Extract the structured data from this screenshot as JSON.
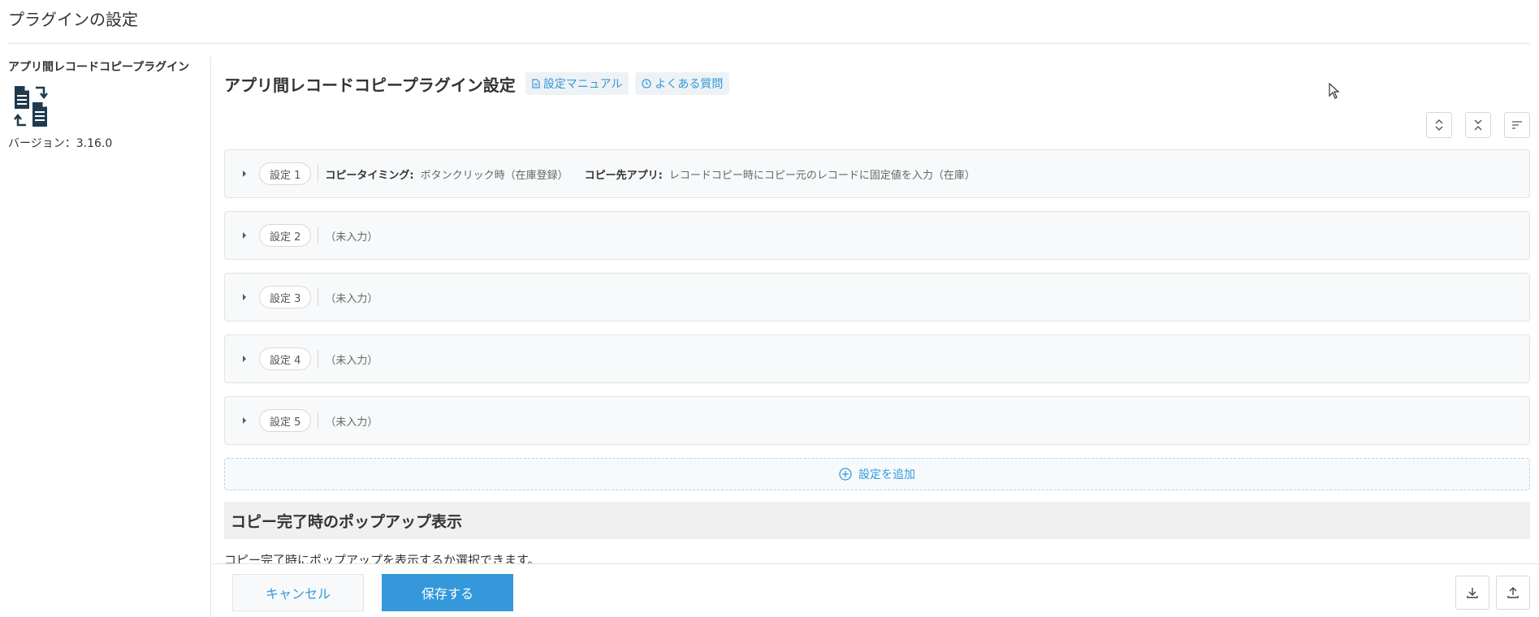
{
  "page": {
    "title": "プラグインの設定"
  },
  "sidebar": {
    "plugin_name": "アプリ間レコードコピープラグイン",
    "version": "バージョン：3.16.0",
    "icon": "copy-documents-icon"
  },
  "main": {
    "title": "アプリ間レコードコピープラグイン設定",
    "links": [
      {
        "label": "設定マニュアル",
        "icon": "document-icon"
      },
      {
        "label": "よくある質問",
        "icon": "question-circle-icon"
      }
    ],
    "tools": [
      "expand-all-icon",
      "collapse-all-icon",
      "sort-icon"
    ]
  },
  "settings": [
    {
      "badge": "設定 1",
      "timing_label": "コピータイミング:",
      "timing_value": "ボタンクリック時（在庫登録）",
      "target_label": "コピー先アプリ:",
      "target_value": "レコードコピー時にコピー元のレコードに固定値を入力（在庫）"
    },
    {
      "badge": "設定 2",
      "empty": "（未入力）"
    },
    {
      "badge": "設定 3",
      "empty": "（未入力）"
    },
    {
      "badge": "設定 4",
      "empty": "（未入力）"
    },
    {
      "badge": "設定 5",
      "empty": "（未入力）"
    }
  ],
  "add_setting": "設定を追加",
  "popup_section": {
    "heading": "コピー完了時のポップアップ表示",
    "description": "コピー完了時にポップアップを表示するか選択できます。"
  },
  "footer": {
    "cancel": "キャンセル",
    "save": "保存する",
    "download_icon": "download-icon",
    "upload_icon": "upload-icon"
  },
  "colors": {
    "accent": "#3498db",
    "panel": "#f7f9fa",
    "border": "#e3e3e3"
  }
}
